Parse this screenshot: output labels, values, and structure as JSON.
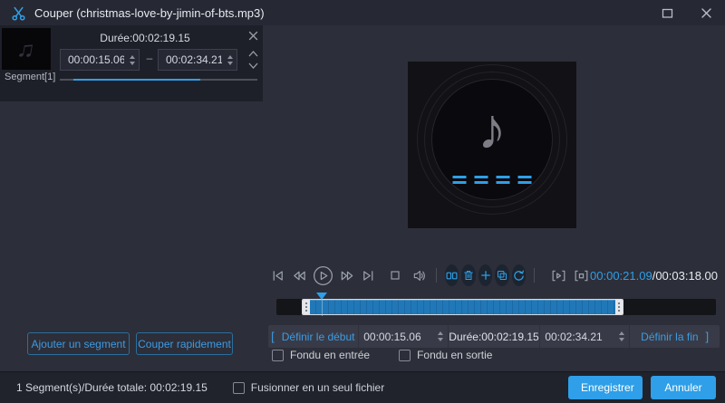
{
  "window": {
    "title": "Couper (christmas-love-by-jimin-of-bts.mp3)"
  },
  "colors": {
    "accent": "#2e9fe8",
    "panel": "#2c2e39",
    "titlebar": "#262833",
    "statusbar": "#20222c"
  },
  "icons": {
    "titlebar": "scissors-icon",
    "window_controls": [
      "maximize-icon",
      "close-icon"
    ],
    "segment_item": [
      "music-notes-thumbnail",
      "remove-segment-icon",
      "move-up-icon",
      "move-down-icon"
    ],
    "transport": [
      "skip-start-icon",
      "rewind-icon",
      "play-icon",
      "fast-forward-icon",
      "skip-end-icon",
      "stop-icon",
      "volume-icon"
    ],
    "edit_tools": [
      "split-icon",
      "delete-icon",
      "add-icon",
      "copy-icon",
      "reset-icon"
    ],
    "preview": [
      "play-selection-icon",
      "stop-selection-icon"
    ],
    "album_art": [
      "music-note-icon",
      "equalizer-bars"
    ]
  },
  "segment_panel": {
    "duration_label": "Durée:00:02:19.15",
    "start_value": "00:00:15.06",
    "range_separator": "–",
    "end_value": "00:02:34.21",
    "segment_label": "Segment[1]",
    "add_segment_button": "Ajouter un segment",
    "quick_cut_button": "Couper rapidement"
  },
  "player": {
    "current_time": "00:00:21.09",
    "time_separator": "/",
    "total_time": "00:03:18.00"
  },
  "trim_bar": {
    "start_bracket": "[",
    "set_start_label": "Définir le début",
    "start_value": "00:00:15.06",
    "duration_label": "Durée:00:02:19.15",
    "end_value": "00:02:34.21",
    "set_end_label": "Définir la fin",
    "end_bracket": "]"
  },
  "fade_options": {
    "fade_in_label": "Fondu en entrée",
    "fade_in_checked": false,
    "fade_out_label": "Fondu en sortie",
    "fade_out_checked": false
  },
  "status_bar": {
    "summary": "1 Segment(s)/Durée totale: 00:02:19.15",
    "merge_label": "Fusionner en un seul fichier",
    "merge_checked": false,
    "save_button": "Enregistrer",
    "cancel_button": "Annuler"
  }
}
